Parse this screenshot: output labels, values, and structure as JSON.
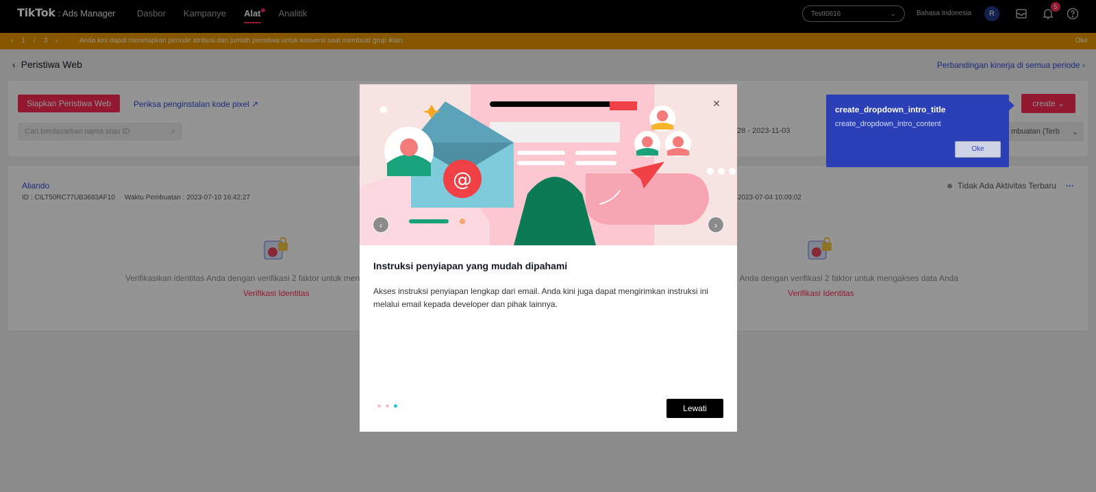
{
  "brand": {
    "name": "TikTok",
    "suffix": ": Ads Manager"
  },
  "nav": {
    "links": [
      {
        "label": "Dasbor"
      },
      {
        "label": "Kampanye"
      },
      {
        "label": "Alat"
      },
      {
        "label": "Analitik"
      }
    ],
    "account": "Testt0616",
    "language": "Bahasa Indonesia",
    "avatar_initial": "R",
    "notifications_count": "5"
  },
  "banner": {
    "pager_current": "1",
    "pager_sep": "/",
    "pager_total": "3",
    "message": "Anda kini dapat menetapkan periode atribusi dan jumlah peristiwa untuk konversi saat membuat grup iklan.",
    "ok": "Oke"
  },
  "page": {
    "title": "Peristiwa Web",
    "compare_link": "Perbandingan kinerja di semua periode",
    "setup_button": "Siapkan Peristiwa Web",
    "pixel_check_link": "Periksa penginstalan kode pixel",
    "search_placeholder": "Cari berdasarkan nama atau ID",
    "create_button": "create",
    "date_range": "28  -  2023-11-03",
    "sort_label": "mbuatan (Terb"
  },
  "items": [
    {
      "name": "Aliando",
      "id_text": "ID : CILT50RC77UB3683AF10",
      "created_text": "Waktu Pembuatan : 2023-07-10 16:42:27",
      "verify_text": "Verifikasikan identitas Anda dengan verifikasi 2 faktor untuk men",
      "verify_link": "Verifikasi Identitas"
    },
    {
      "created_text": "2023-07-04 10:09:02",
      "status": "Tidak Ada Aktivitas Terbaru",
      "verify_text": "itas Anda dengan verifikasi 2 faktor untuk mengakses data Anda",
      "verify_link": "Verifikasi Identitas"
    }
  ],
  "intro_tooltip": {
    "title": "create_dropdown_intro_title",
    "content": "create_dropdown_intro_content",
    "ok": "Oke"
  },
  "modal": {
    "title": "Instruksi penyiapan yang mudah dipahami",
    "body": "Akses instruksi penyiapan lengkap dari email. Anda kini juga dapat mengirimkan instruksi ini melalui email kepada developer dan pihak lainnya.",
    "skip_button": "Lewati",
    "active_step": 3,
    "total_steps": 3
  },
  "colors": {
    "accent": "#fe2c55",
    "link": "#2f4bd4",
    "banner": "#e99700",
    "tooltip": "#2b3fb7",
    "active_dot": "#25c7d3"
  }
}
